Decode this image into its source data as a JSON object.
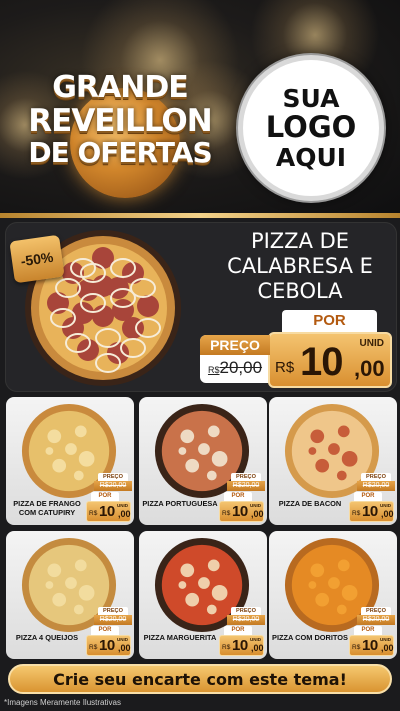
{
  "header": {
    "promo_lines": [
      "GRANDE",
      "REVEILLON",
      "DE OFERTAS"
    ],
    "logo_lines": [
      "SUA",
      "LOGO",
      "AQUI"
    ]
  },
  "featured": {
    "discount": "-50%",
    "title": "PIZZA DE CALABRESA E CEBOLA",
    "por_label": "POR",
    "preco_label": "PREÇO",
    "old_currency": "R$",
    "old_price": "20,00",
    "unit_label": "UNID",
    "currency": "R$",
    "price_int": "10",
    "price_dec": ",00"
  },
  "products": [
    {
      "name": "PIZZA DE FRANGO COM CATUPIRY",
      "preco_label": "PREÇO",
      "old_price": "R$20,00",
      "por_label": "POR",
      "currency": "R$",
      "price_int": "10",
      "price_dec": ",00",
      "unit_label": "UNID",
      "style": "frango"
    },
    {
      "name": "PIZZA PORTUGUESA",
      "preco_label": "PREÇO",
      "old_price": "R$20,00",
      "por_label": "POR",
      "currency": "R$",
      "price_int": "10",
      "price_dec": ",00",
      "unit_label": "UNID",
      "style": "portuguesa"
    },
    {
      "name": "PIZZA DE BACON",
      "preco_label": "PREÇO",
      "old_price": "R$20,00",
      "por_label": "POR",
      "currency": "R$",
      "price_int": "10",
      "price_dec": ",00",
      "unit_label": "UNID",
      "style": "bacon"
    },
    {
      "name": "PIZZA 4 QUEIJOS",
      "preco_label": "PREÇO",
      "old_price": "R$20,00",
      "por_label": "POR",
      "currency": "R$",
      "price_int": "10",
      "price_dec": ",00",
      "unit_label": "UNID",
      "style": "queijos"
    },
    {
      "name": "PIZZA MARGUERITA",
      "preco_label": "PREÇO",
      "old_price": "R$20,00",
      "por_label": "POR",
      "currency": "R$",
      "price_int": "10",
      "price_dec": ",00",
      "unit_label": "UNID",
      "style": "marguerita"
    },
    {
      "name": "PIZZA COM DORITOS",
      "preco_label": "PREÇO",
      "old_price": "R$20,00",
      "por_label": "POR",
      "currency": "R$",
      "price_int": "10",
      "price_dec": ",00",
      "unit_label": "UNID",
      "style": "doritos"
    }
  ],
  "cta": {
    "label": "Crie seu encarte com este tema!"
  },
  "footer": {
    "disclaimer": "*Imagens Meramente Ilustrativas"
  },
  "colors": {
    "gold": "#d99431",
    "gold_light": "#f5c86f",
    "dark_bg": "#1b1b1d",
    "card_bg": "#ececec",
    "price_text": "#2a1605"
  },
  "icons": {
    "pizza": "pizza-image"
  }
}
